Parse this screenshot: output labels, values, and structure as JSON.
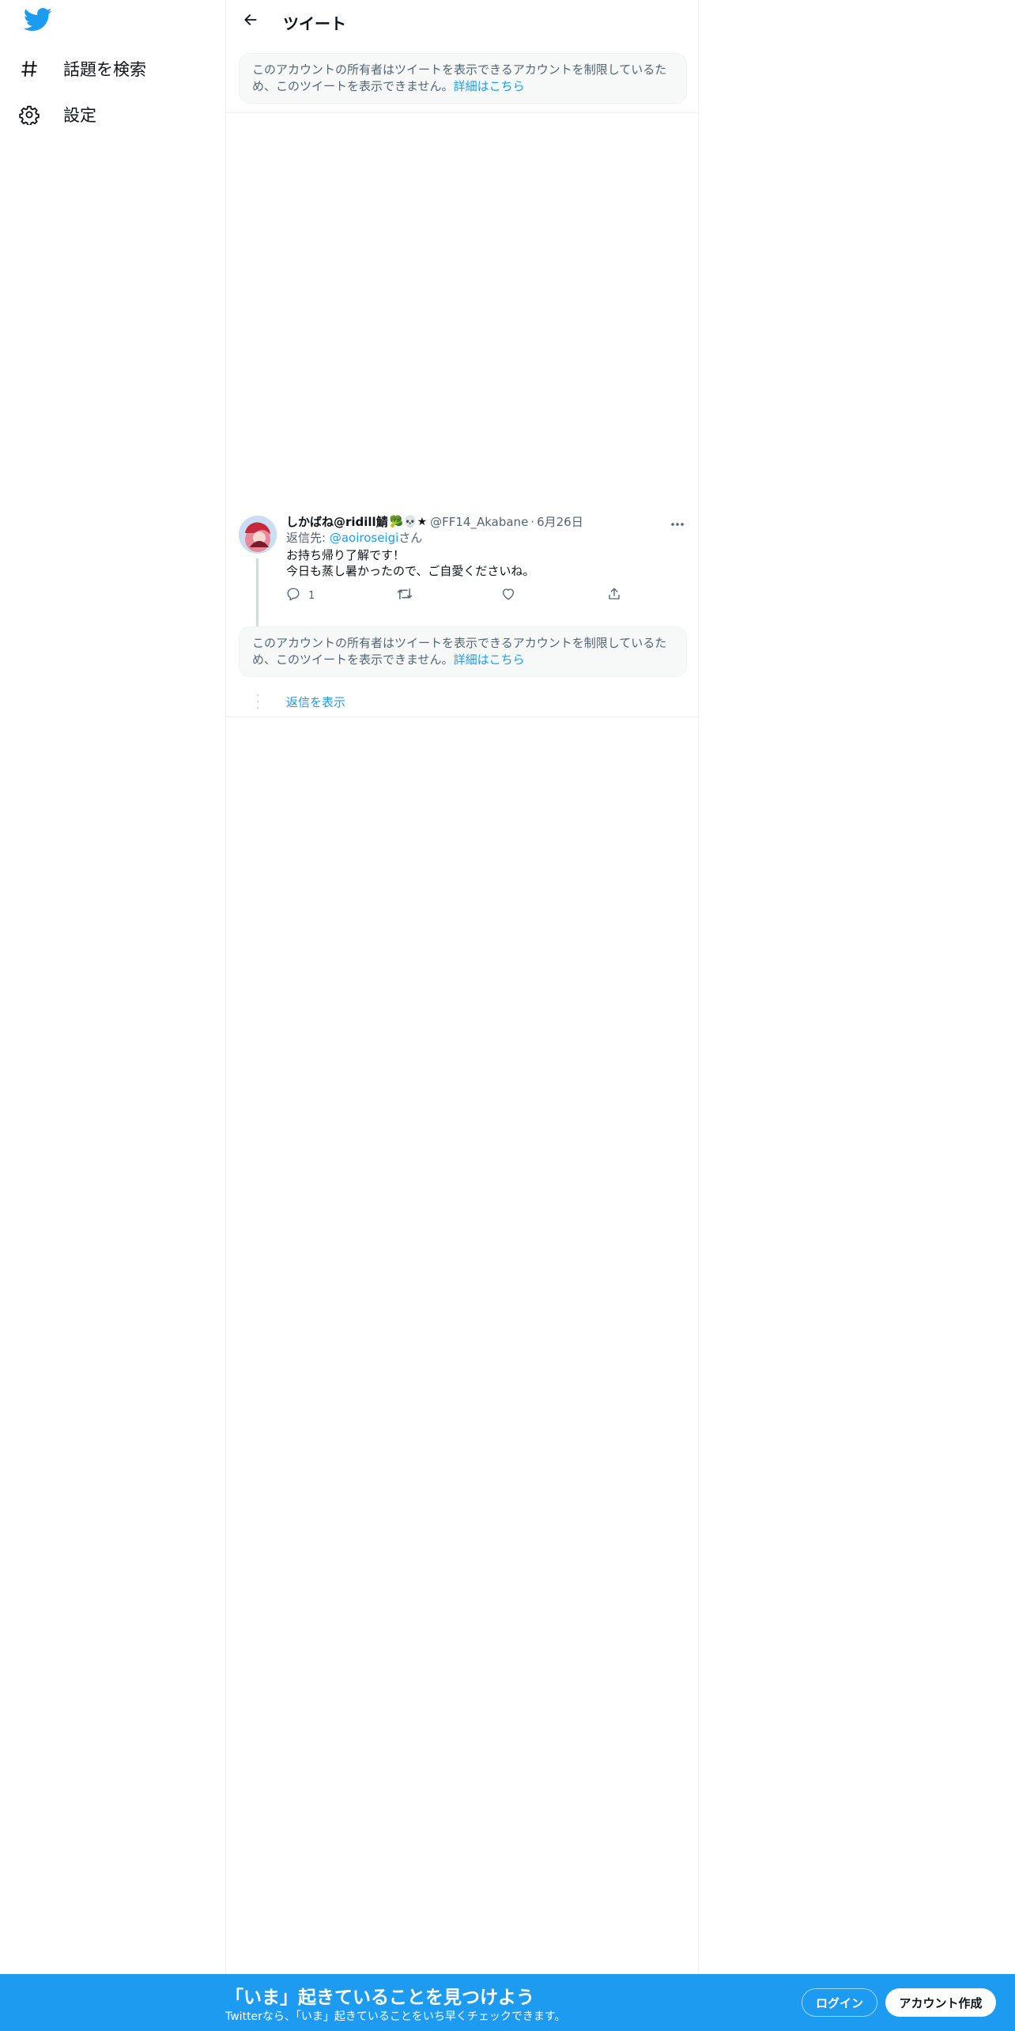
{
  "sidebar": {
    "logo_icon": "twitter-bird-icon",
    "items": [
      {
        "icon": "hashtag-icon",
        "label": "話題を検索"
      },
      {
        "icon": "gear-icon",
        "label": "設定"
      }
    ]
  },
  "header": {
    "back_icon": "arrow-left-icon",
    "title": "ツイート"
  },
  "notice_top": {
    "text": "このアカウントの所有者はツイートを表示できるアカウントを制限しているため、このツイートを表示できません。",
    "link": "詳細はこちら"
  },
  "tweet": {
    "name": "しかばね@ridill鯖",
    "emojis": "🥦💀★",
    "handle": "@FF14_Akabane",
    "dot": "·",
    "time": "6月26日",
    "reply_prefix": "返信先: ",
    "reply_mention": "@aoiroseigi",
    "reply_suffix": "さん",
    "text_line1": "お持ち帰り了解です！",
    "text_line2": "今日も蒸し暑かったので、ご自愛くださいね。",
    "reply_count": "1"
  },
  "notice_bottom": {
    "text": "このアカウントの所有者はツイートを表示できるアカウントを制限しているため、このツイートを表示できません。",
    "link": "詳細はこちら"
  },
  "show_replies": "返信を表示",
  "bottom_bar": {
    "title": "「いま」起きていることを見つけよう",
    "subtitle": "Twitterなら、「いま」起きていることをいち早くチェックできます。",
    "login": "ログイン",
    "signup": "アカウント作成"
  },
  "colors": {
    "brand": "#1d9bf0",
    "text": "#0f1419",
    "secondary": "#536471"
  }
}
